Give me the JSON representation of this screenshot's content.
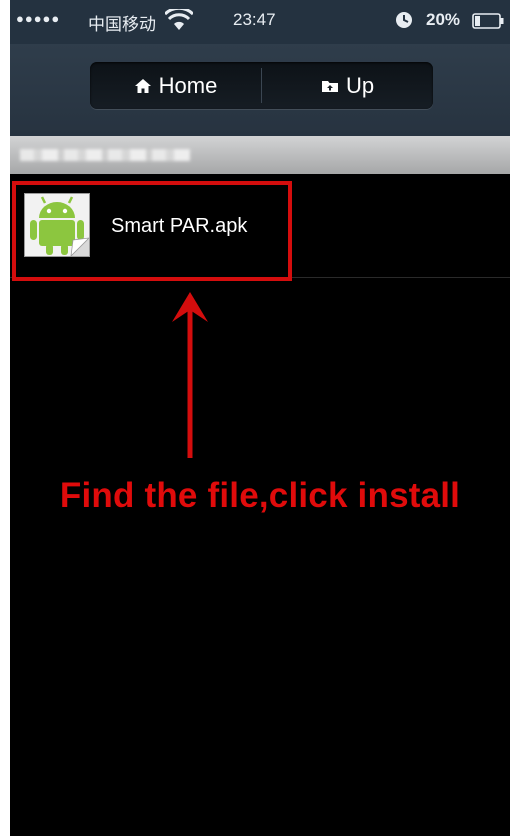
{
  "status_bar": {
    "signal": "●●●●●",
    "carrier": "中国移动",
    "time": "23:47",
    "battery": "20%",
    "icons": [
      "wifi-icon",
      "alarm-icon",
      "battery-icon"
    ]
  },
  "toolbar": {
    "home_label": "Home",
    "home_icon": "home-icon",
    "up_label": "Up",
    "up_icon": "folder-up-icon"
  },
  "file_list": {
    "items": [
      {
        "name": "Smart PAR.apk",
        "icon": "android-apk-icon"
      }
    ]
  },
  "annotation": {
    "text": "Find the file,click install",
    "color": "#e00b0b"
  }
}
